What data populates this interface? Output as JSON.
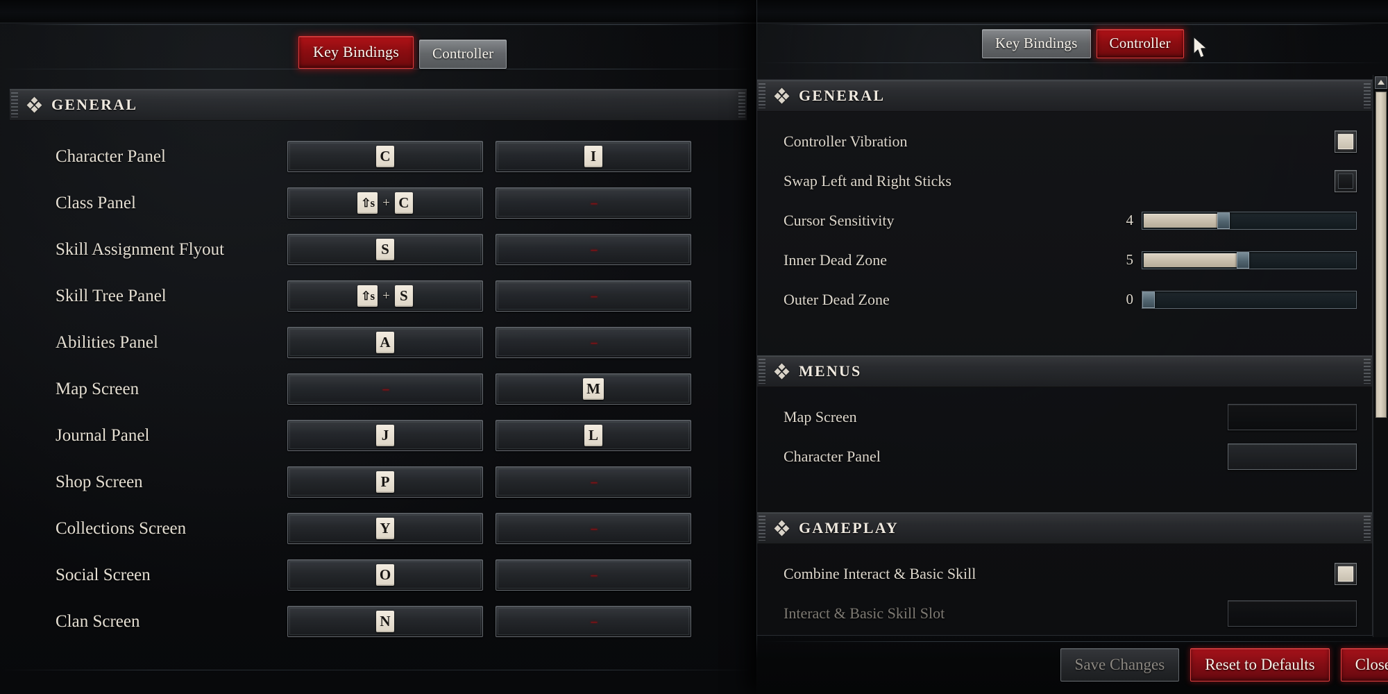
{
  "left_panel": {
    "tabs": [
      {
        "label": "Key Bindings",
        "state": "active"
      },
      {
        "label": "Controller",
        "state": "inactive"
      }
    ],
    "section": {
      "title": "GENERAL",
      "icon": "diamond-cluster-icon"
    },
    "columns": [
      "primary",
      "secondary"
    ],
    "unbound_glyph": "--",
    "shift_key_label": "⇧s",
    "plus_glyph": "+",
    "bindings": [
      {
        "action": "Character Panel",
        "primary": {
          "keys": [
            "C"
          ]
        },
        "secondary": {
          "keys": [
            "I"
          ]
        }
      },
      {
        "action": "Class Panel",
        "primary": {
          "keys": [
            "⇧s",
            "C"
          ]
        },
        "secondary": {
          "keys": []
        }
      },
      {
        "action": "Skill Assignment Flyout",
        "primary": {
          "keys": [
            "S"
          ]
        },
        "secondary": {
          "keys": []
        }
      },
      {
        "action": "Skill Tree Panel",
        "primary": {
          "keys": [
            "⇧s",
            "S"
          ]
        },
        "secondary": {
          "keys": []
        }
      },
      {
        "action": "Abilities Panel",
        "primary": {
          "keys": [
            "A"
          ]
        },
        "secondary": {
          "keys": []
        }
      },
      {
        "action": "Map Screen",
        "primary": {
          "keys": []
        },
        "secondary": {
          "keys": [
            "M"
          ]
        }
      },
      {
        "action": "Journal Panel",
        "primary": {
          "keys": [
            "J"
          ]
        },
        "secondary": {
          "keys": [
            "L"
          ]
        }
      },
      {
        "action": "Shop Screen",
        "primary": {
          "keys": [
            "P"
          ]
        },
        "secondary": {
          "keys": []
        }
      },
      {
        "action": "Collections Screen",
        "primary": {
          "keys": [
            "Y"
          ]
        },
        "secondary": {
          "keys": []
        }
      },
      {
        "action": "Social Screen",
        "primary": {
          "keys": [
            "O"
          ]
        },
        "secondary": {
          "keys": []
        }
      },
      {
        "action": "Clan Screen",
        "primary": {
          "keys": [
            "N"
          ]
        },
        "secondary": {
          "keys": []
        }
      }
    ]
  },
  "right_panel": {
    "tabs": [
      {
        "label": "Key Bindings",
        "state": "inactive"
      },
      {
        "label": "Controller",
        "state": "active"
      }
    ],
    "sections": [
      {
        "title": "GENERAL",
        "icon": "diamond-cluster-icon",
        "rows": [
          {
            "label": "Controller Vibration",
            "control": "checkbox",
            "checked": true,
            "enabled": true
          },
          {
            "label": "Swap Left and Right Sticks",
            "control": "checkbox",
            "checked": false,
            "enabled": true
          },
          {
            "label": "Cursor Sensitivity",
            "control": "slider",
            "value": 4,
            "percent": 38,
            "enabled": true
          },
          {
            "label": "Inner Dead Zone",
            "control": "slider",
            "value": 5,
            "percent": 47,
            "enabled": true
          },
          {
            "label": "Outer Dead Zone",
            "control": "slider",
            "value": 0,
            "percent": 0,
            "enabled": true
          }
        ]
      },
      {
        "title": "MENUS",
        "icon": "diamond-cluster-icon",
        "rows": [
          {
            "label": "Map Screen",
            "control": "bindbox",
            "value": "",
            "style": "flat",
            "enabled": true
          },
          {
            "label": "Character Panel",
            "control": "bindbox",
            "value": "",
            "style": "raised",
            "enabled": true
          }
        ]
      },
      {
        "title": "GAMEPLAY",
        "icon": "diamond-cluster-icon",
        "rows": [
          {
            "label": "Combine Interact & Basic Skill",
            "control": "checkbox",
            "checked": true,
            "enabled": true
          },
          {
            "label": "Interact & Basic Skill Slot",
            "control": "bindbox",
            "value": "",
            "style": "flat",
            "enabled": false
          }
        ]
      }
    ],
    "scrollbar": {
      "up_arrow_icon": "chevron-up-icon",
      "thumb_position_percent": 0
    }
  },
  "footer": {
    "buttons": [
      {
        "label": "Save Changes",
        "style": "disabled"
      },
      {
        "label": "Reset to Defaults",
        "style": "danger"
      },
      {
        "label": "Close",
        "style": "danger"
      }
    ]
  },
  "cursor": {
    "icon": "mouse-pointer-icon"
  },
  "colors": {
    "accent_red": "#8d0d11",
    "accent_red_glow": "#e03b3b",
    "text_primary": "#e4ded2",
    "text_dim": "#7e7a73",
    "keycap_bg": "#ddd5c6",
    "unbound_red": "#7d1216",
    "slider_fill": "#c7bdab",
    "slider_track": "#182025",
    "scroll_thumb": "#ded5c4"
  }
}
